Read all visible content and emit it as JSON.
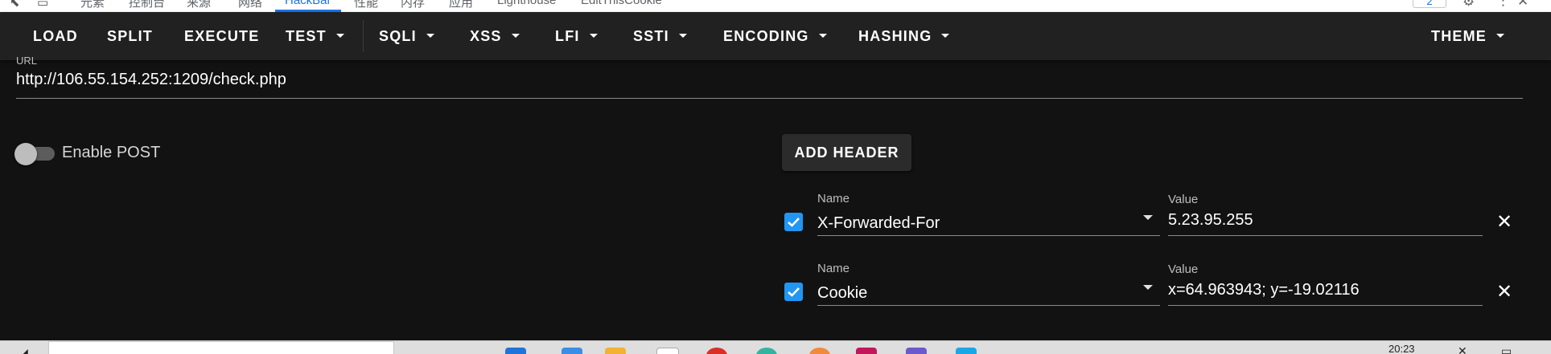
{
  "devtools_tabs": {
    "items": [
      {
        "label": "元素"
      },
      {
        "label": "控制台"
      },
      {
        "label": "来源"
      },
      {
        "label": "网络"
      },
      {
        "label": "HackBar",
        "active": true
      },
      {
        "label": "性能"
      },
      {
        "label": "内存"
      },
      {
        "label": "应用"
      },
      {
        "label": "Lighthouse"
      },
      {
        "label": "EditThisCookie"
      }
    ],
    "badge_count": "2"
  },
  "toolbar": {
    "load": "LOAD",
    "split": "SPLIT",
    "execute": "EXECUTE",
    "test": "TEST",
    "sqli": "SQLI",
    "xss": "XSS",
    "lfi": "LFI",
    "ssti": "SSTI",
    "encoding": "ENCODING",
    "hashing": "HASHING",
    "theme": "THEME"
  },
  "url": {
    "label": "URL",
    "value": "http://106.55.154.252:1209/check.php"
  },
  "post_toggle": {
    "label": "Enable POST",
    "enabled": false
  },
  "add_header_button": "ADD HEADER",
  "headers": [
    {
      "enabled": true,
      "name_label": "Name",
      "name": "X-Forwarded-For",
      "value_label": "Value",
      "value": "5.23.95.255"
    },
    {
      "enabled": true,
      "name_label": "Name",
      "name": "Cookie",
      "value_label": "Value",
      "value": "x=64.963943; y=-19.02116"
    }
  ],
  "taskbar": {
    "clock": "20:23"
  },
  "colors": {
    "background": "#121212",
    "toolbar": "#212121",
    "accent": "#2196f3"
  }
}
